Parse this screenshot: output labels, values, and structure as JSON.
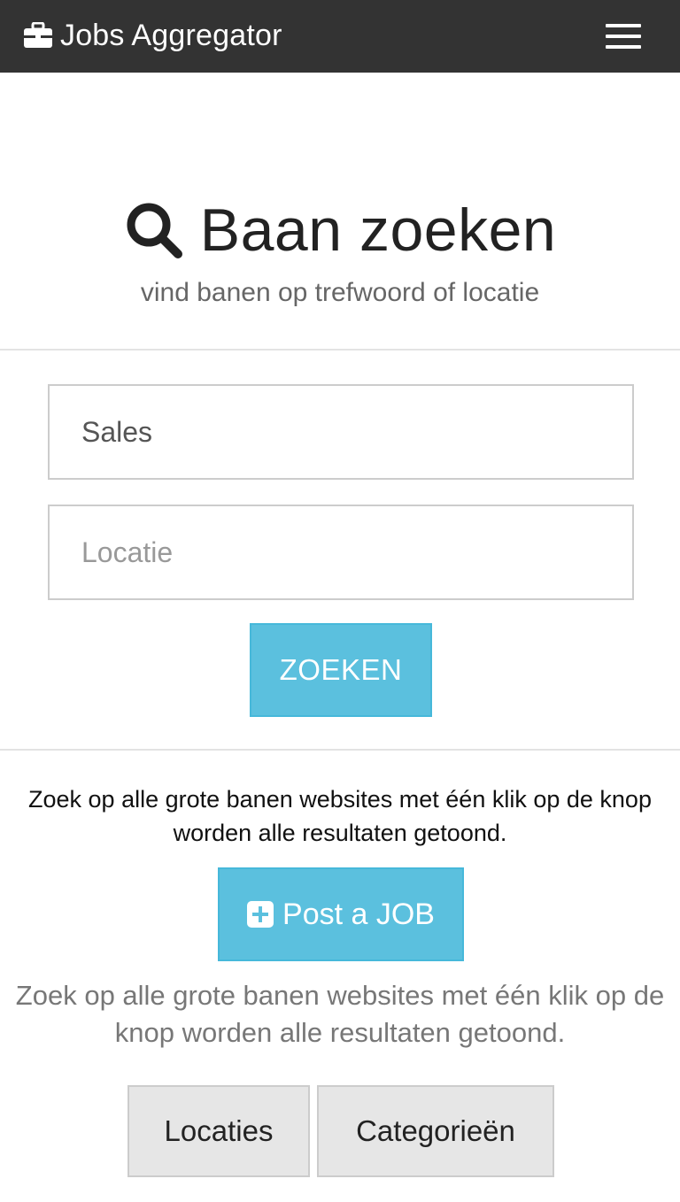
{
  "navbar": {
    "brand": "Jobs Aggregator",
    "brand_icon": "briefcase-icon",
    "menu_icon": "hamburger-menu-icon"
  },
  "hero": {
    "title": "Baan zoeken",
    "title_icon": "search-icon",
    "subtitle": "vind banen op trefwoord of locatie"
  },
  "search_form": {
    "keyword_value": "Sales",
    "location_placeholder": "Locatie",
    "submit_label": "ZOEKEN"
  },
  "info": {
    "text": "Zoek op alle grote banen websites met één klik op de knop worden alle resultaten getoond.",
    "post_job_label": "Post a JOB",
    "post_job_icon": "plus-square-icon",
    "text_secondary": "Zoek op alle grote banen websites met één klik op de knop worden alle resultaten getoond."
  },
  "browse": {
    "locations_label": "Locaties",
    "categories_label": "Categorieën"
  },
  "colors": {
    "navbar_bg": "#333333",
    "accent": "#5bc0de",
    "secondary_button_bg": "#e6e6e6"
  }
}
